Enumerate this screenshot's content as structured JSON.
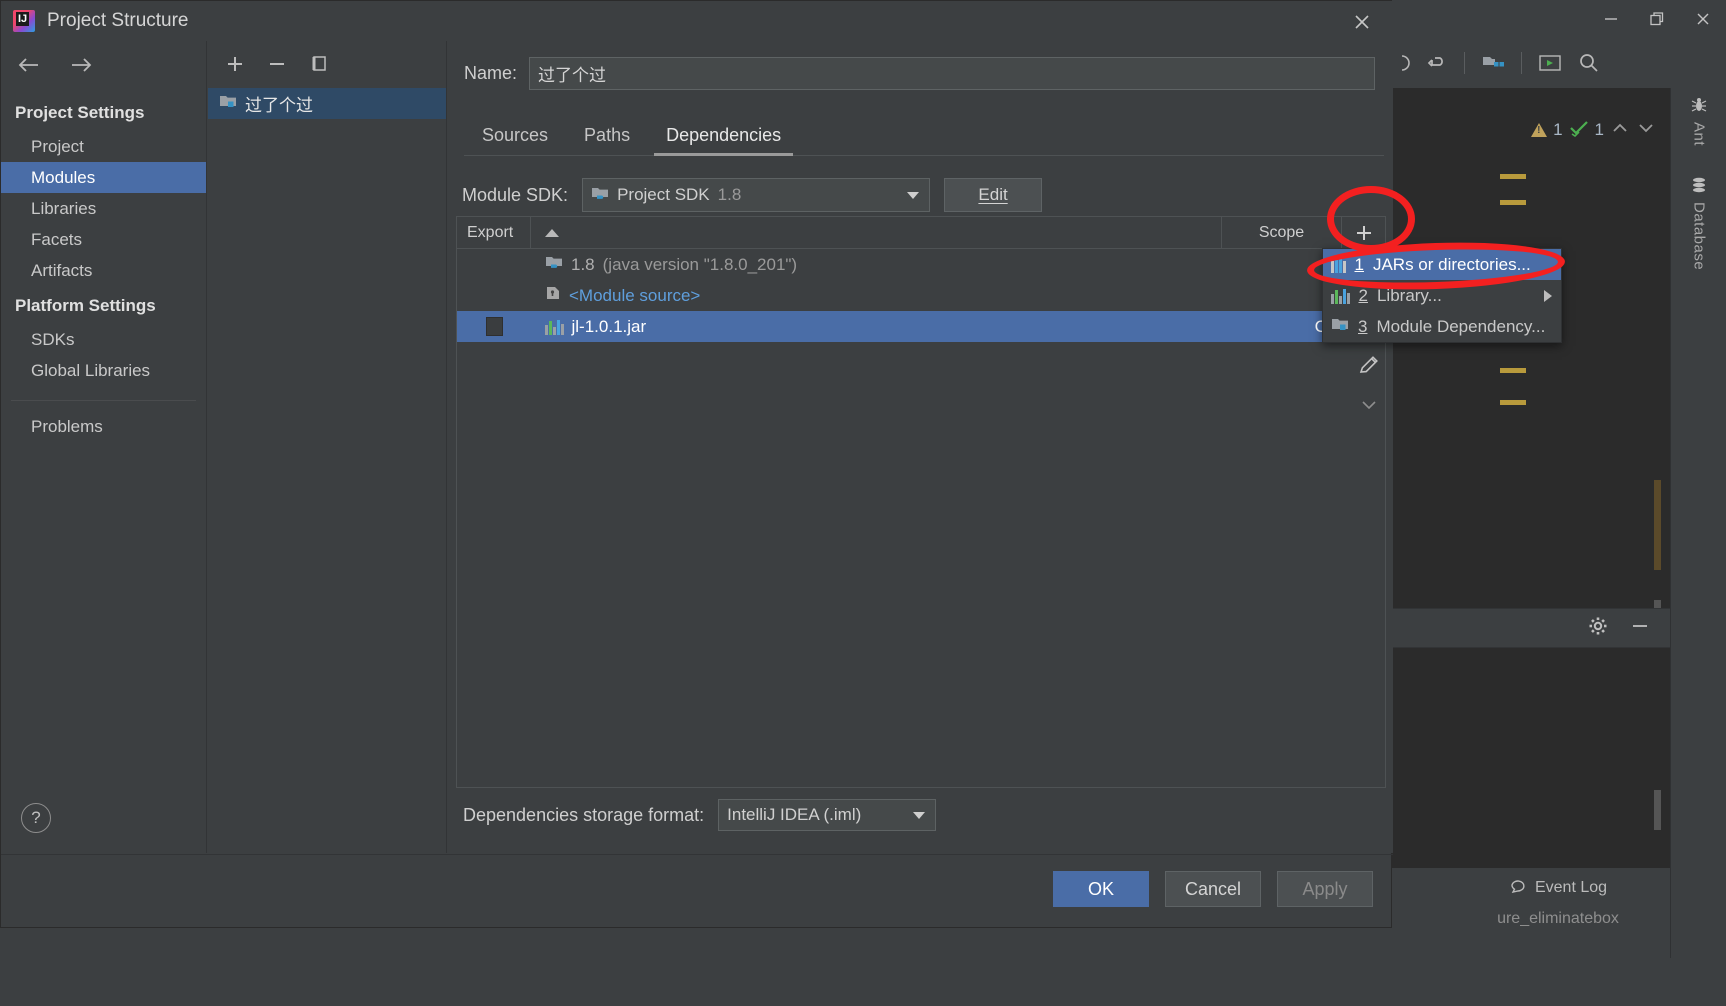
{
  "dialog": {
    "title": "Project Structure",
    "logo_icon": "intellij-logo-icon",
    "close_icon": "close-icon",
    "nav": {
      "back_icon": "arrow-left-icon",
      "forward_icon": "arrow-right-icon",
      "groups": [
        {
          "label": "Project Settings",
          "items": [
            {
              "label": "Project",
              "selected": false
            },
            {
              "label": "Modules",
              "selected": true
            },
            {
              "label": "Libraries",
              "selected": false
            },
            {
              "label": "Facets",
              "selected": false
            },
            {
              "label": "Artifacts",
              "selected": false
            }
          ]
        },
        {
          "label": "Platform Settings",
          "items": [
            {
              "label": "SDKs",
              "selected": false
            },
            {
              "label": "Global Libraries",
              "selected": false
            }
          ]
        }
      ],
      "problems_label": "Problems",
      "help_label": "?"
    },
    "module_list": {
      "add_icon": "plus-icon",
      "remove_icon": "minus-icon",
      "copy_icon": "copy-icon",
      "modules": [
        {
          "name": "过了个过",
          "icon": "module-folder-icon",
          "selected": true
        }
      ]
    },
    "main": {
      "name_label": "Name:",
      "name_value": "过了个过",
      "tabs": [
        {
          "label": "Sources",
          "active": false
        },
        {
          "label": "Paths",
          "active": false
        },
        {
          "label": "Dependencies",
          "active": true
        }
      ],
      "module_sdk_label": "Module SDK:",
      "module_sdk_value": "Project SDK",
      "module_sdk_value_muted": "1.8",
      "module_sdk_icon": "java-sdk-icon",
      "edit_button": "Edit",
      "table": {
        "columns": [
          "Export",
          "",
          "Scope"
        ],
        "sort_indicator": "sort-ascending-icon",
        "add_icon": "plus-icon",
        "rows": [
          {
            "export_checked": false,
            "has_checkbox": false,
            "icon": "java-sdk-icon",
            "name": "1.8",
            "name_suffix": "(java version \"1.8.0_201\")",
            "scope": "",
            "selected": false,
            "link": false
          },
          {
            "export_checked": false,
            "has_checkbox": false,
            "icon": "module-source-icon",
            "name": "<Module source>",
            "name_suffix": "",
            "scope": "",
            "selected": false,
            "link": true
          },
          {
            "export_checked": false,
            "has_checkbox": true,
            "icon": "jar-icon",
            "name": "jl-1.0.1.jar",
            "name_suffix": "",
            "scope": "Compile",
            "selected": true,
            "link": false
          }
        ]
      },
      "side_actions": [
        {
          "icon": "edit-pencil-icon"
        }
      ],
      "storage_label": "Dependencies storage format:",
      "storage_value": "IntelliJ IDEA (.iml)"
    },
    "footer": {
      "ok": "OK",
      "cancel": "Cancel",
      "apply": "Apply"
    }
  },
  "popup_menu": {
    "items": [
      {
        "num": "1",
        "label": "JARs or directories...",
        "icon": "jar-icon",
        "selected": true,
        "submenu": false
      },
      {
        "num": "2",
        "label": "Library...",
        "icon": "bars-icon",
        "selected": false,
        "submenu": true
      },
      {
        "num": "3",
        "label": "Module Dependency...",
        "icon": "module-folder-icon",
        "selected": false,
        "submenu": false
      }
    ]
  },
  "ide": {
    "window_controls": {
      "minimize_icon": "minimize-icon",
      "restore_icon": "restore-icon",
      "close_icon": "close-icon"
    },
    "toolbar_icons": [
      "undo-icon",
      "project-structure-icon",
      "run-icon",
      "search-icon"
    ],
    "inspections": {
      "warning_icon": "warning-triangle-icon",
      "warning_count": "1",
      "ok_icon": "checkmark-icon",
      "ok_count": "1",
      "prev_icon": "chevron-up-icon",
      "next_icon": "chevron-down-icon"
    },
    "sidebar_tabs": [
      {
        "label": "Ant",
        "icon": "ant-bug-icon"
      },
      {
        "label": "Database",
        "icon": "database-icon"
      }
    ],
    "panel_header_icons": [
      "gear-icon",
      "minimize-panel-icon"
    ],
    "status": {
      "event_log_label": "Event Log",
      "event_log_icon": "event-log-icon",
      "hidden_text": "ure_eliminatebox"
    }
  },
  "annotations": {
    "circle_target": "plus-button-highlight",
    "ellipse_target": "jars-or-directories-highlight",
    "color": "#f32020"
  },
  "colors": {
    "selection": "#4a6da7",
    "bg": "#3c3f41",
    "editor_bg": "#2b2b2b",
    "link": "#5f9fdd",
    "annotation": "#f32020"
  }
}
